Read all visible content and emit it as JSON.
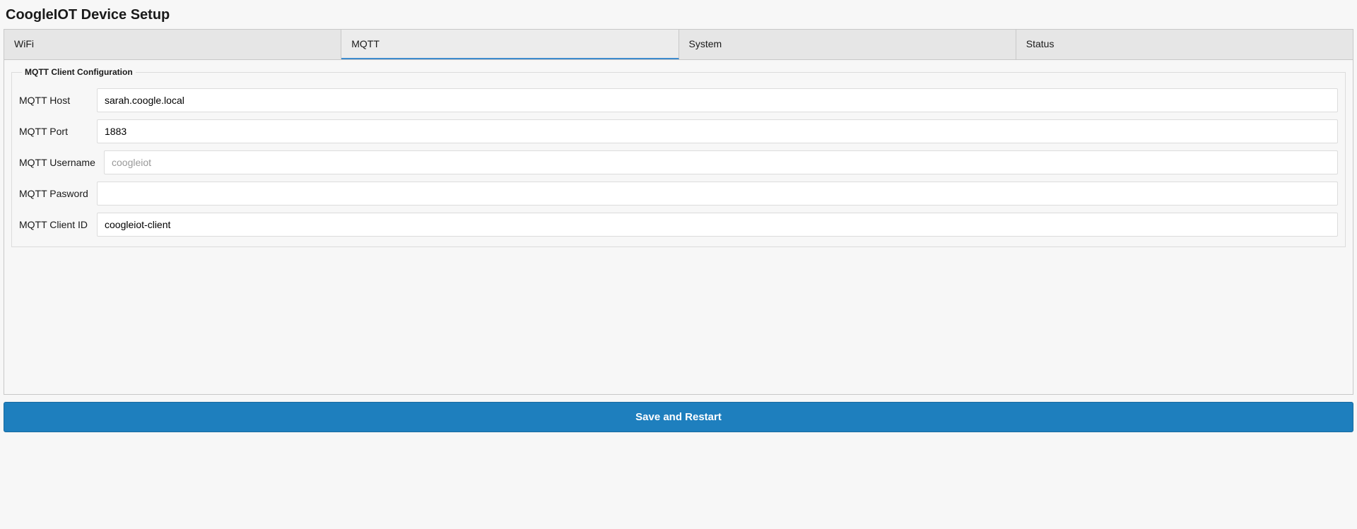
{
  "header": {
    "title": "CoogleIOT Device Setup"
  },
  "tabs": [
    {
      "id": "wifi",
      "label": "WiFi"
    },
    {
      "id": "mqtt",
      "label": "MQTT"
    },
    {
      "id": "system",
      "label": "System"
    },
    {
      "id": "status",
      "label": "Status"
    }
  ],
  "active_tab": "mqtt",
  "mqtt": {
    "legend": "MQTT Client Configuration",
    "fields": {
      "host": {
        "label": "MQTT Host",
        "value": "sarah.coogle.local",
        "placeholder": ""
      },
      "port": {
        "label": "MQTT Port",
        "value": "1883",
        "placeholder": ""
      },
      "username": {
        "label": "MQTT Username",
        "value": "",
        "placeholder": "coogleiot"
      },
      "password": {
        "label": "MQTT Pasword",
        "value": "",
        "placeholder": ""
      },
      "client_id": {
        "label": "MQTT Client ID",
        "value": "coogleiot-client",
        "placeholder": ""
      }
    }
  },
  "footer": {
    "save_label": "Save and Restart"
  }
}
